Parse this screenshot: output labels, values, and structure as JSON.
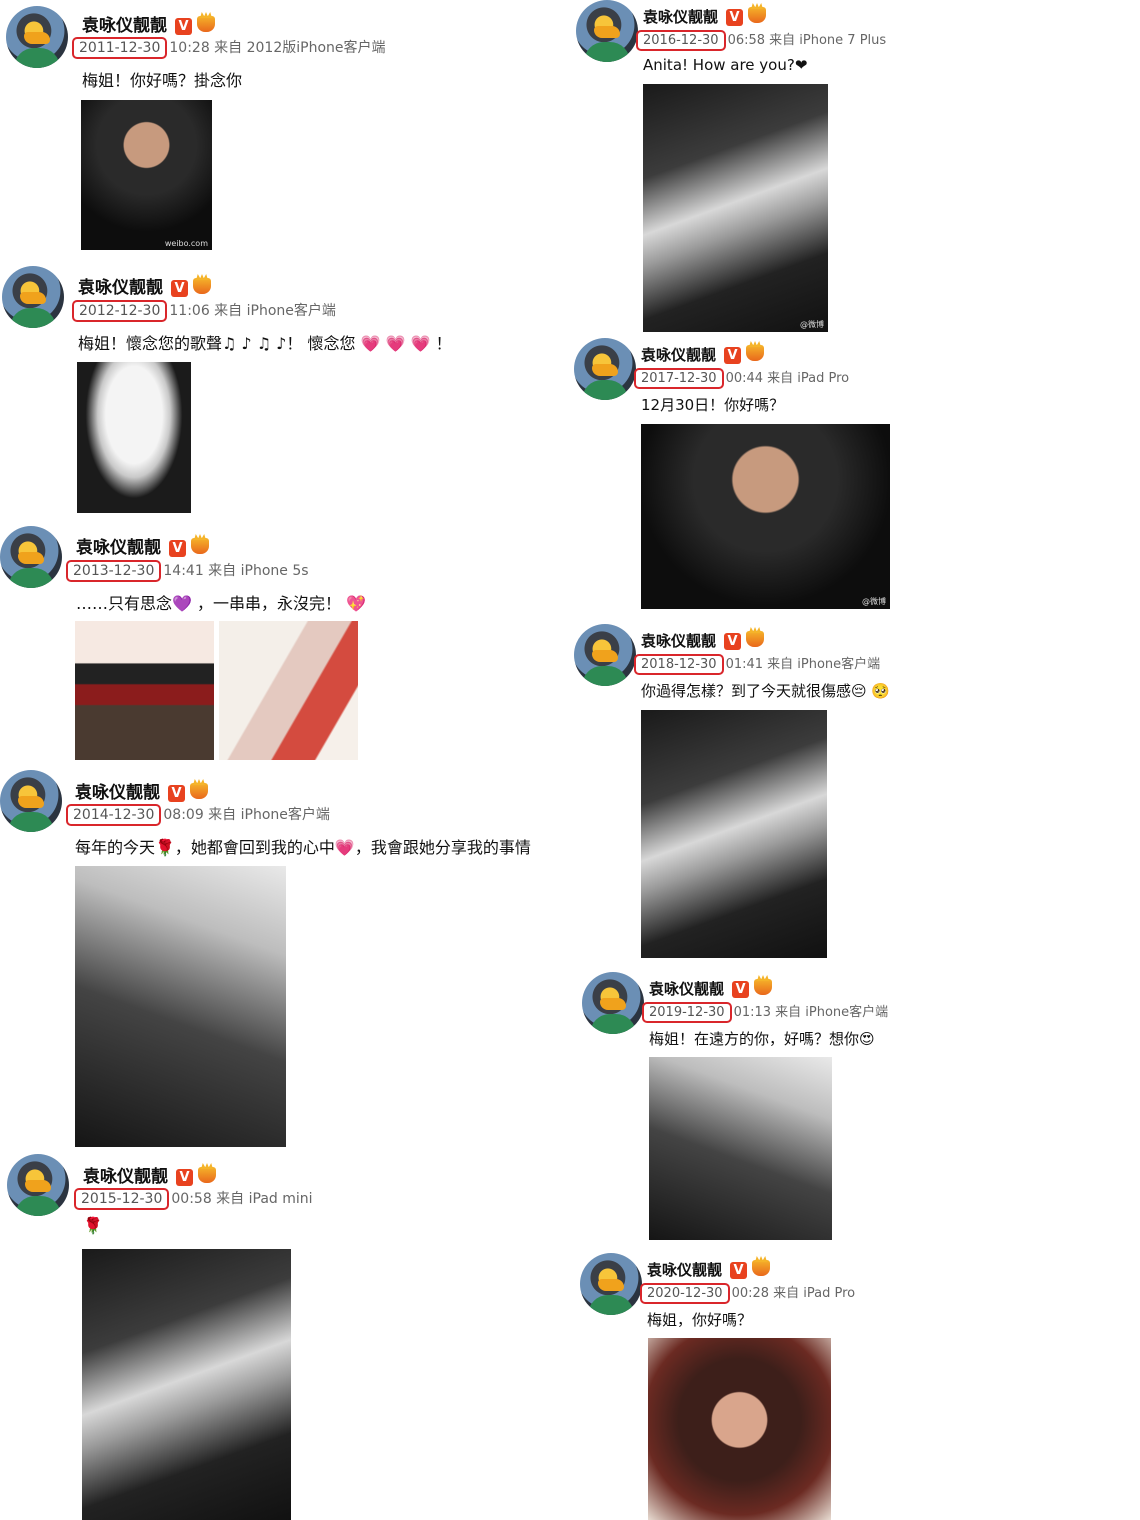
{
  "username": "袁咏仪靓靓",
  "verified_label": "V",
  "posts": [
    {
      "date": "2011-12-30",
      "rest": "10:28 来自 2012版iPhone客户端",
      "text": "梅姐！你好嗎？掛念你"
    },
    {
      "date": "2012-12-30",
      "rest": "11:06 来自 iPhone客户端",
      "text": "梅姐！懷念您的歌聲♫ ♪ ♫ ♪！ 懷念您 💗 💗 💗 ！"
    },
    {
      "date": "2013-12-30",
      "rest": "14:41 来自 iPhone 5s",
      "text": "……只有思念💜 ，一串串，永沒完！ 💖"
    },
    {
      "date": "2014-12-30",
      "rest": "08:09 来自 iPhone客户端",
      "text": "每年的今天🌹，她都會回到我的心中💗，我會跟她分享我的事情"
    },
    {
      "date": "2015-12-30",
      "rest": "00:58 来自 iPad mini",
      "text": "🌹"
    },
    {
      "date": "2016-12-30",
      "rest": "06:58 来自 iPhone 7 Plus",
      "text": "Anita! How are you?❤"
    },
    {
      "date": "2017-12-30",
      "rest": "00:44 来自 iPad Pro",
      "text": "12月30日！你好嗎？"
    },
    {
      "date": "2018-12-30",
      "rest": "01:41 来自 iPhone客户端",
      "text": "你過得怎樣？到了今天就很傷感😔 🥺"
    },
    {
      "date": "2019-12-30",
      "rest": "01:13 来自 iPhone客户端",
      "text": "梅姐！在遠方的你，好嗎？想你😍"
    },
    {
      "date": "2020-12-30",
      "rest": "00:28 来自 iPad Pro",
      "text": "梅姐，你好嗎？"
    }
  ],
  "watermarks": {
    "p1": "weibo.com",
    "p6": "@微博",
    "p7": "@微博"
  }
}
